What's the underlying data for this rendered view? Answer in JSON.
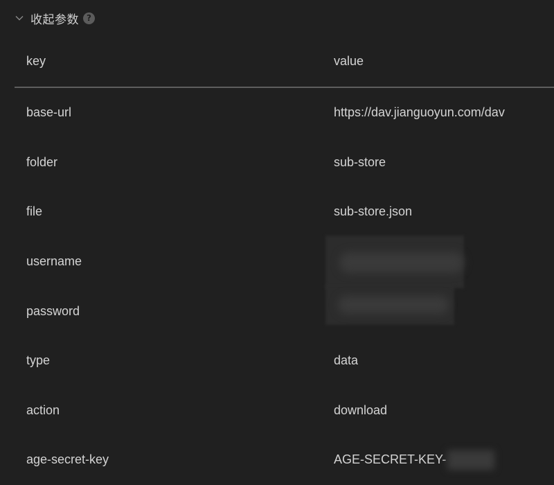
{
  "section": {
    "title": "收起参数",
    "help_glyph": "?"
  },
  "table": {
    "columns": {
      "key": "key",
      "value": "value"
    },
    "rows": [
      {
        "key": "base-url",
        "value": "https://dav.jianguoyun.com/dav"
      },
      {
        "key": "folder",
        "value": "sub-store"
      },
      {
        "key": "file",
        "value": "sub-store.json"
      },
      {
        "key": "username",
        "value": ""
      },
      {
        "key": "password",
        "value": ""
      },
      {
        "key": "type",
        "value": "data"
      },
      {
        "key": "action",
        "value": "download"
      },
      {
        "key": "age-secret-key",
        "value": "AGE-SECRET-KEY-"
      }
    ]
  },
  "icons": {
    "collapse": "chevron-down-icon",
    "help": "question-circle-icon"
  },
  "colors": {
    "background": "#202020",
    "text": "#d4d4d4",
    "divider": "#5e5e5e",
    "help_icon_bg": "#5c5c5c"
  }
}
